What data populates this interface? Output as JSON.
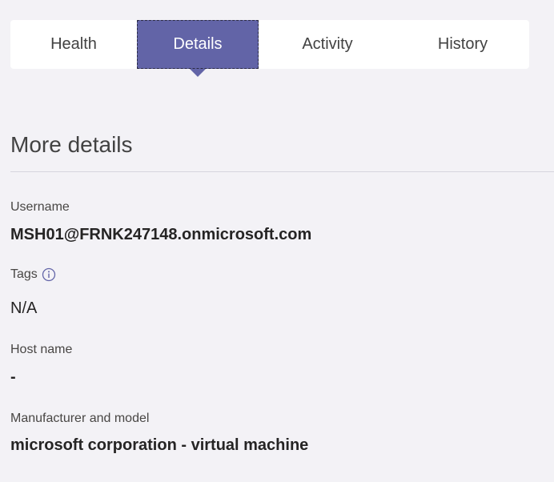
{
  "tabs": [
    {
      "label": "Health"
    },
    {
      "label": "Details"
    },
    {
      "label": "Activity"
    },
    {
      "label": "History"
    }
  ],
  "active_tab": "Details",
  "section": {
    "title": "More details"
  },
  "fields": {
    "username": {
      "label": "Username",
      "value": "MSH01@FRNK247148.onmicrosoft.com"
    },
    "tags": {
      "label": "Tags",
      "value": "N/A",
      "icon": "info-icon"
    },
    "host_name": {
      "label": "Host name",
      "value": "-"
    },
    "manufacturer": {
      "label": "Manufacturer and model",
      "value": "microsoft corporation - virtual machine"
    }
  },
  "colors": {
    "accent": "#6264a7",
    "background": "#f3f2f6",
    "info_icon": "#6264a7"
  }
}
